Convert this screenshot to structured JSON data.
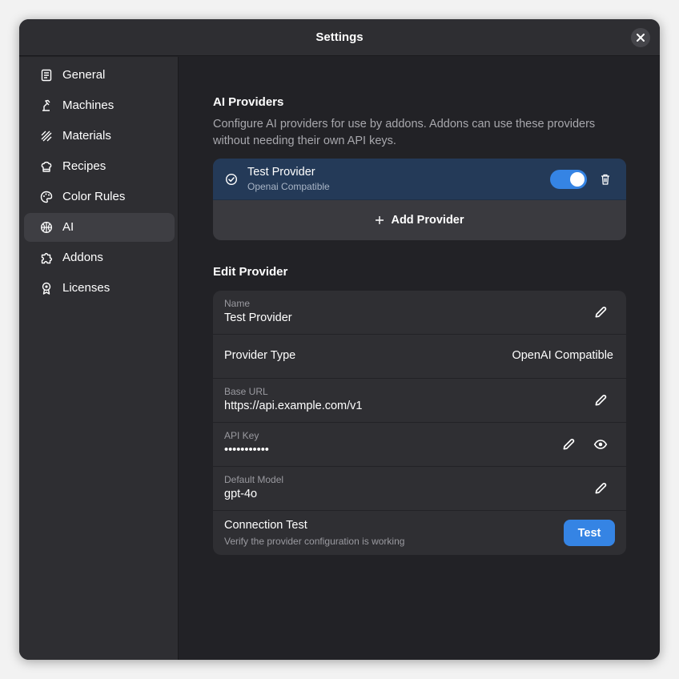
{
  "window": {
    "title": "Settings"
  },
  "sidebar": {
    "items": [
      {
        "label": "General",
        "icon": "general-icon"
      },
      {
        "label": "Machines",
        "icon": "machines-icon"
      },
      {
        "label": "Materials",
        "icon": "materials-icon"
      },
      {
        "label": "Recipes",
        "icon": "recipes-icon"
      },
      {
        "label": "Color Rules",
        "icon": "palette-icon"
      },
      {
        "label": "AI",
        "icon": "ai-icon",
        "active": true
      },
      {
        "label": "Addons",
        "icon": "puzzle-icon"
      },
      {
        "label": "Licenses",
        "icon": "license-icon"
      }
    ]
  },
  "ai_providers": {
    "heading": "AI Providers",
    "description": "Configure AI providers for use by addons. Addons can use these providers without needing their own API keys.",
    "provider": {
      "name": "Test Provider",
      "type": "Openai Compatible",
      "enabled": true
    },
    "add_label": "Add Provider"
  },
  "edit_provider": {
    "heading": "Edit Provider",
    "name_caption": "Name",
    "name_value": "Test Provider",
    "type_label": "Provider Type",
    "type_value": "OpenAI Compatible",
    "base_url_caption": "Base URL",
    "base_url_value": "https://api.example.com/v1",
    "api_key_caption": "API Key",
    "api_key_value": "•••••••••••",
    "model_caption": "Default Model",
    "model_value": "gpt-4o",
    "conn_title": "Connection Test",
    "conn_sub": "Verify the provider configuration is working",
    "test_label": "Test"
  },
  "colors": {
    "accent": "#3584e4",
    "selected_row": "#243a58"
  }
}
